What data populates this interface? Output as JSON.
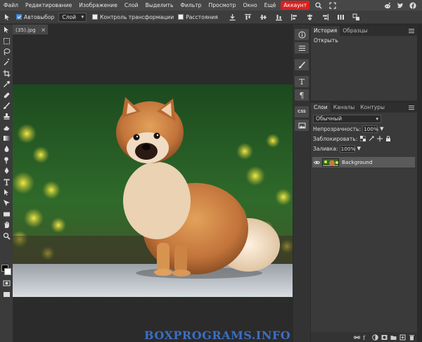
{
  "menu": {
    "items": [
      "Файл",
      "Редактирование",
      "Изображение",
      "Слой",
      "Выделить",
      "Фильтр",
      "Просмотр",
      "Окно",
      "Ещё"
    ],
    "account_label": "Аккаунт"
  },
  "options": {
    "auto_select_label": "Автовыбор",
    "auto_select_checked": true,
    "target_value": "Слой",
    "transform_controls_label": "Контроль трансформации",
    "distances_label": "Расстояния"
  },
  "document": {
    "tab_title": "(35).jpg",
    "close_glyph": "×"
  },
  "history_panel": {
    "tabs": [
      "История",
      "Образцы"
    ],
    "entries": [
      "Открыть"
    ]
  },
  "layers_panel": {
    "tabs": [
      "Слои",
      "Каналы",
      "Контуры"
    ],
    "blend_mode": "Обычный",
    "opacity_label": "Непрозрачность:",
    "opacity_value": "100%",
    "lock_label": "Заблокировать:",
    "fill_label": "Заливка:",
    "fill_value": "100%",
    "layers": [
      {
        "name": "Background",
        "visible": true
      }
    ]
  },
  "mini_panel": {
    "text_glyph": "T",
    "para_glyph": "¶",
    "css_label": "CSS"
  },
  "watermark": "BOXPROGRAMS.INFO",
  "colors": {
    "accent": "#d92020",
    "foreground_swatch": "#000000",
    "background_swatch": "#ffffff",
    "watermark": "#3a6fc4"
  },
  "icons": [
    "search-icon",
    "fullscreen-icon",
    "reddit-icon",
    "twitter-icon",
    "facebook-icon",
    "download-icon",
    "settings-icon",
    "eye-icon"
  ]
}
